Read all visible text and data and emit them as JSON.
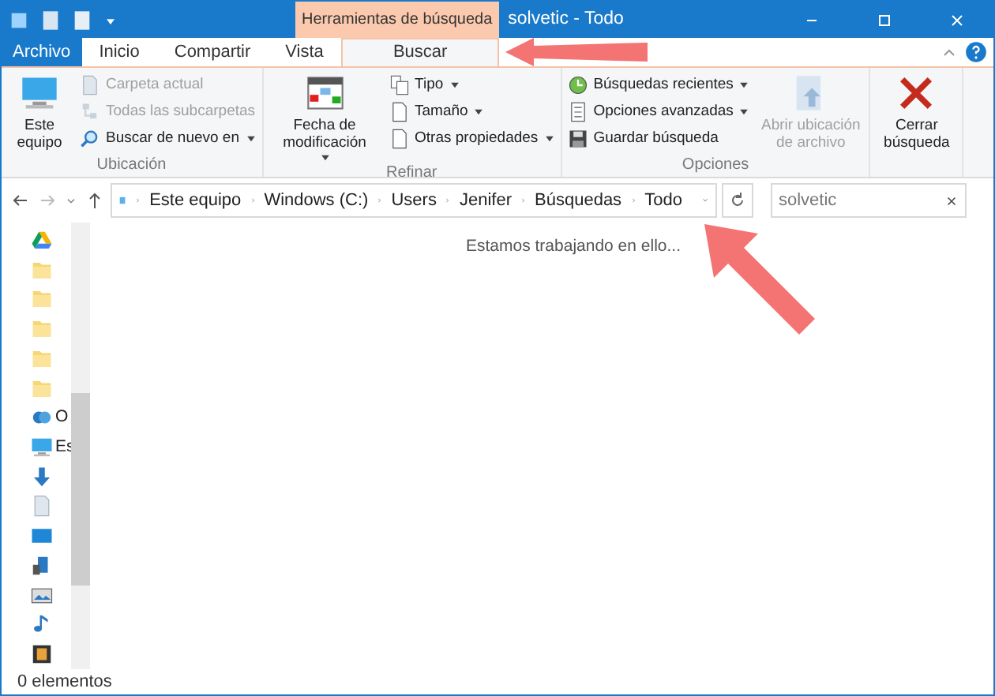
{
  "window": {
    "title": "solvetic - Todo",
    "context_tab": "Herramientas de búsqueda"
  },
  "tabs": [
    {
      "label": "Archivo",
      "kind": "file",
      "selected": false
    },
    {
      "label": "Inicio",
      "kind": "tab",
      "selected": false
    },
    {
      "label": "Compartir",
      "kind": "tab",
      "selected": false
    },
    {
      "label": "Vista",
      "kind": "tab",
      "selected": false
    },
    {
      "label": "Buscar",
      "kind": "tab",
      "selected": true
    }
  ],
  "ribbon": [
    {
      "name": "Ubicación",
      "items": [
        {
          "kind": "large",
          "label": "Este equipo",
          "disabled": false,
          "dropdown": false
        },
        {
          "kind": "small",
          "label": "Carpeta actual",
          "disabled": true,
          "dropdown": false
        },
        {
          "kind": "small",
          "label": "Todas las subcarpetas",
          "disabled": true,
          "dropdown": false
        },
        {
          "kind": "small",
          "label": "Buscar de nuevo en",
          "disabled": false,
          "dropdown": true
        }
      ]
    },
    {
      "name": "Refinar",
      "items": [
        {
          "kind": "large",
          "label": "Fecha de modificación",
          "disabled": false,
          "dropdown": true
        },
        {
          "kind": "small",
          "label": "Tipo",
          "disabled": false,
          "dropdown": true
        },
        {
          "kind": "small",
          "label": "Tamaño",
          "disabled": false,
          "dropdown": true
        },
        {
          "kind": "small",
          "label": "Otras propiedades",
          "disabled": false,
          "dropdown": true
        }
      ]
    },
    {
      "name": "Opciones",
      "items": [
        {
          "kind": "small",
          "label": "Búsquedas recientes",
          "disabled": false,
          "dropdown": true
        },
        {
          "kind": "small",
          "label": "Opciones avanzadas",
          "disabled": false,
          "dropdown": true
        },
        {
          "kind": "small",
          "label": "Guardar búsqueda",
          "disabled": false,
          "dropdown": false
        },
        {
          "kind": "large",
          "label": "Abrir ubicación de archivo",
          "disabled": true,
          "dropdown": false
        }
      ]
    },
    {
      "items": [
        {
          "kind": "large",
          "label": "Cerrar búsqueda",
          "disabled": false,
          "dropdown": false
        }
      ]
    }
  ],
  "address": {
    "path": [
      "Este equipo",
      "Windows (C:)",
      "Users",
      "Jenifer",
      "Búsquedas",
      "Todo"
    ],
    "search": "solvetic"
  },
  "sidebar": [
    {
      "label": "O"
    },
    {
      "label": "Es"
    }
  ],
  "message": "Estamos trabajando en ello...",
  "status": "0 elementos",
  "annotations": [
    {
      "kind": "arrow"
    },
    {
      "kind": "arrow"
    }
  ]
}
